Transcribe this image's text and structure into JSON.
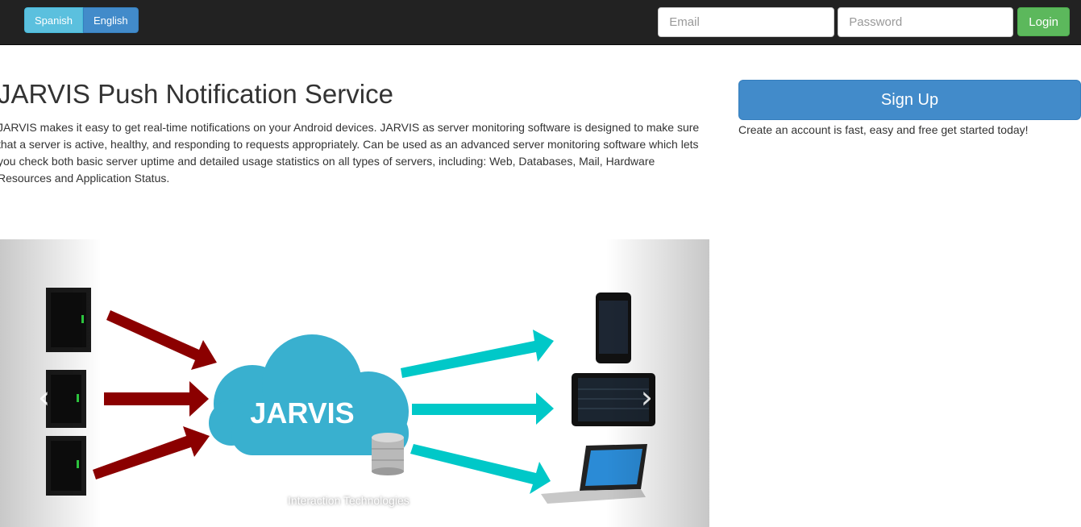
{
  "nav": {
    "languages": [
      "Spanish",
      "English"
    ],
    "email_placeholder": "Email",
    "password_placeholder": "Password",
    "login_label": "Login"
  },
  "main": {
    "title": "JARVIS Push Notification Service",
    "description": "JARVIS makes it easy to get real-time notifications on your Android devices. JARVIS as server monitoring software is designed to make sure that a server is active, healthy, and responding to requests appropriately. Can be used as an advanced server monitoring software which lets you check both basic server uptime and detailed usage statistics on all types of servers, including: Web, Databases, Mail, Hardware Resources and Application Status.",
    "carousel": {
      "cloud_label": "JARVIS",
      "caption": "Interaction Technologies",
      "prev_glyph": "‹",
      "next_glyph": "›",
      "colors": {
        "cloud": "#39b0cf",
        "in_arrow": "#8b0000",
        "out_arrow": "#00c8c8"
      }
    }
  },
  "side": {
    "signup_label": "Sign Up",
    "note": "Create an account is fast, easy and free get started today!"
  }
}
